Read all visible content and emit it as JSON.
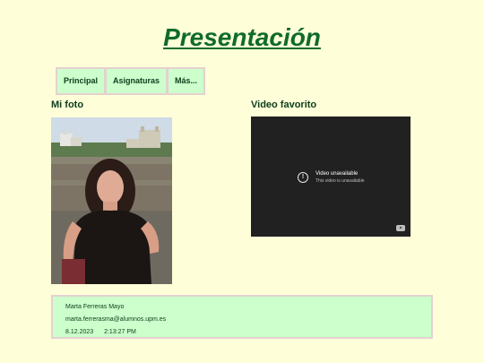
{
  "page": {
    "title": "Presentación"
  },
  "nav": {
    "items": [
      {
        "label": "Principal"
      },
      {
        "label": "Asignaturas"
      },
      {
        "label": "Más..."
      }
    ]
  },
  "photo_section": {
    "label": "Mi foto"
  },
  "video_section": {
    "label": "Video favorito",
    "player": {
      "title": "Video unavailable",
      "subtitle": "This video is unavailable",
      "icon": "info-icon",
      "logo_icon": "youtube-icon"
    }
  },
  "footer": {
    "name": "Marta Ferreras Mayo",
    "email": "marta.ferrerasma@alumnos.upm.es",
    "date": "8.12.2023",
    "time": "2:13:27 PM"
  },
  "colors": {
    "background": "#fefed9",
    "title": "#0f6b2b",
    "nav_bg": "#ccffcc",
    "border": "#e4d2cf",
    "video_bg": "#212121"
  }
}
